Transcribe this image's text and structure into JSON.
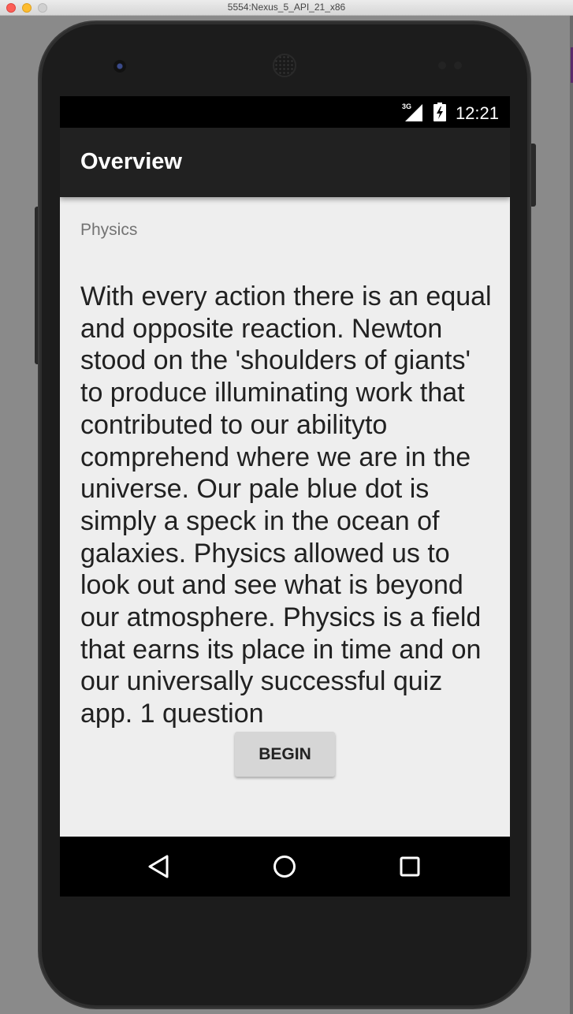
{
  "window": {
    "title": "5554:Nexus_5_API_21_x86"
  },
  "status_bar": {
    "network": "3G",
    "time": "12:21"
  },
  "app_bar": {
    "title": "Overview"
  },
  "content": {
    "category": "Physics",
    "description": "With every action there is an equal and opposite reaction. Newton stood on the 'shoulders of giants' to produce illuminating work that contributed to our abilityto comprehend where we are in the universe.  Our pale blue dot is simply a speck in the ocean of galaxies.  Physics allowed us to look out and see what is beyond our atmosphere. Physics is a field that earns its place in time and on our universally successful quiz app. 1 question",
    "begin_label": "BEGIN"
  },
  "nav_bar": {
    "icons": [
      "back-icon",
      "home-icon",
      "recents-icon"
    ]
  },
  "colors": {
    "app_bar": "#212121",
    "screen_bg": "#eeeeee",
    "button_bg": "#d6d6d6"
  }
}
